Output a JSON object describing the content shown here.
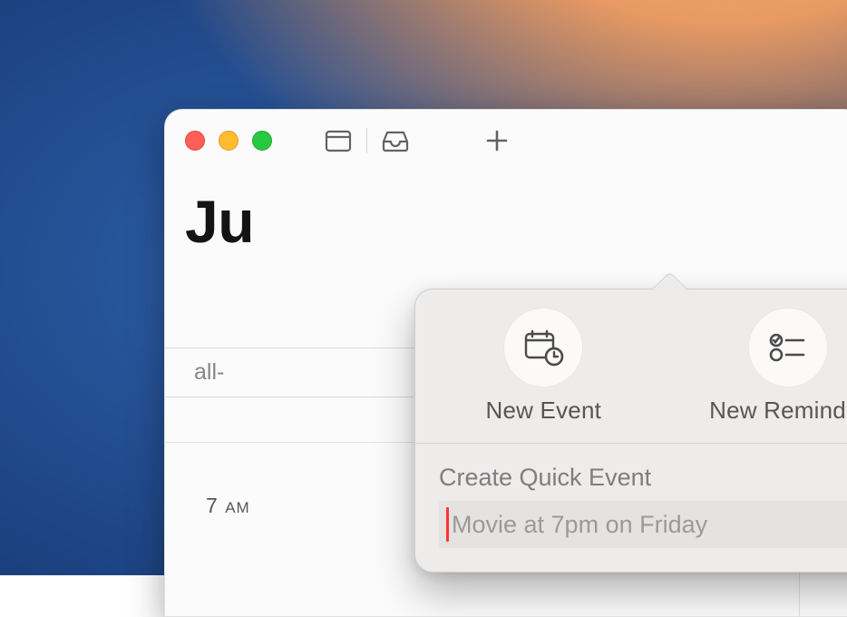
{
  "window": {
    "month_prefix": "Ju"
  },
  "toolbar": {
    "close": "close",
    "minimize": "minimize",
    "zoom": "zoom"
  },
  "calendar": {
    "allday_label": "all-",
    "hour_label_number": "7",
    "hour_label_period": "AM",
    "peek_dots": "..."
  },
  "popover": {
    "new_event_label": "New Event",
    "new_reminder_label": "New Reminder",
    "quick_label": "Create Quick Event",
    "quick_placeholder": "Movie at 7pm on Friday"
  }
}
